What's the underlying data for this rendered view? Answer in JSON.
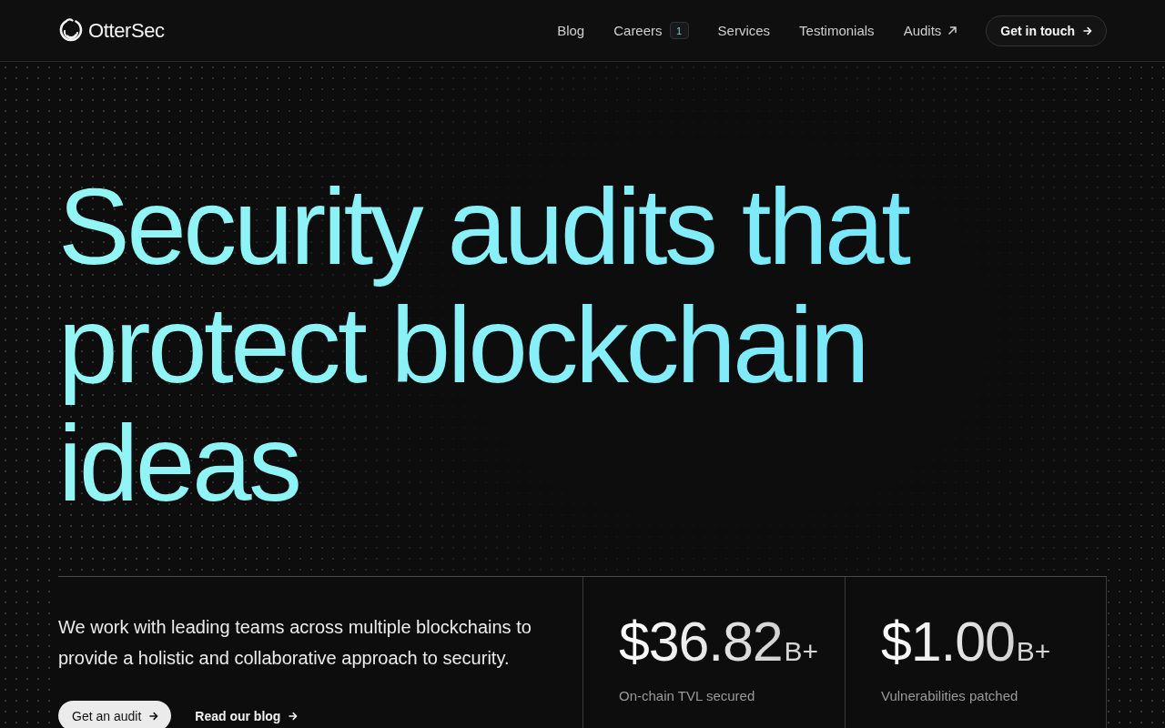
{
  "header": {
    "logo": {
      "text": "OtterSec"
    },
    "nav": [
      {
        "label": "Blog",
        "kind": "plain"
      },
      {
        "label": "Careers",
        "kind": "badge",
        "badge": "1"
      },
      {
        "label": "Services",
        "kind": "plain"
      },
      {
        "label": "Testimonials",
        "kind": "plain"
      },
      {
        "label": "Audits",
        "kind": "external"
      }
    ],
    "cta": {
      "label": "Get in touch"
    }
  },
  "hero": {
    "heading": "Security audits that protect blockchain ideas"
  },
  "intro": {
    "text": "We work with leading teams across multiple blockchains to provide a holistic and collaborative approach to security.",
    "buttons": [
      {
        "label": "Get an audit",
        "kind": "primary"
      },
      {
        "label": "Read our blog",
        "kind": "text"
      }
    ]
  },
  "stats": [
    {
      "value": "$36.82",
      "suffix": "B+",
      "label": "On-chain TVL secured"
    },
    {
      "value": "$1.00",
      "suffix": "B+",
      "label": "Vulnerabilities patched"
    }
  ]
}
